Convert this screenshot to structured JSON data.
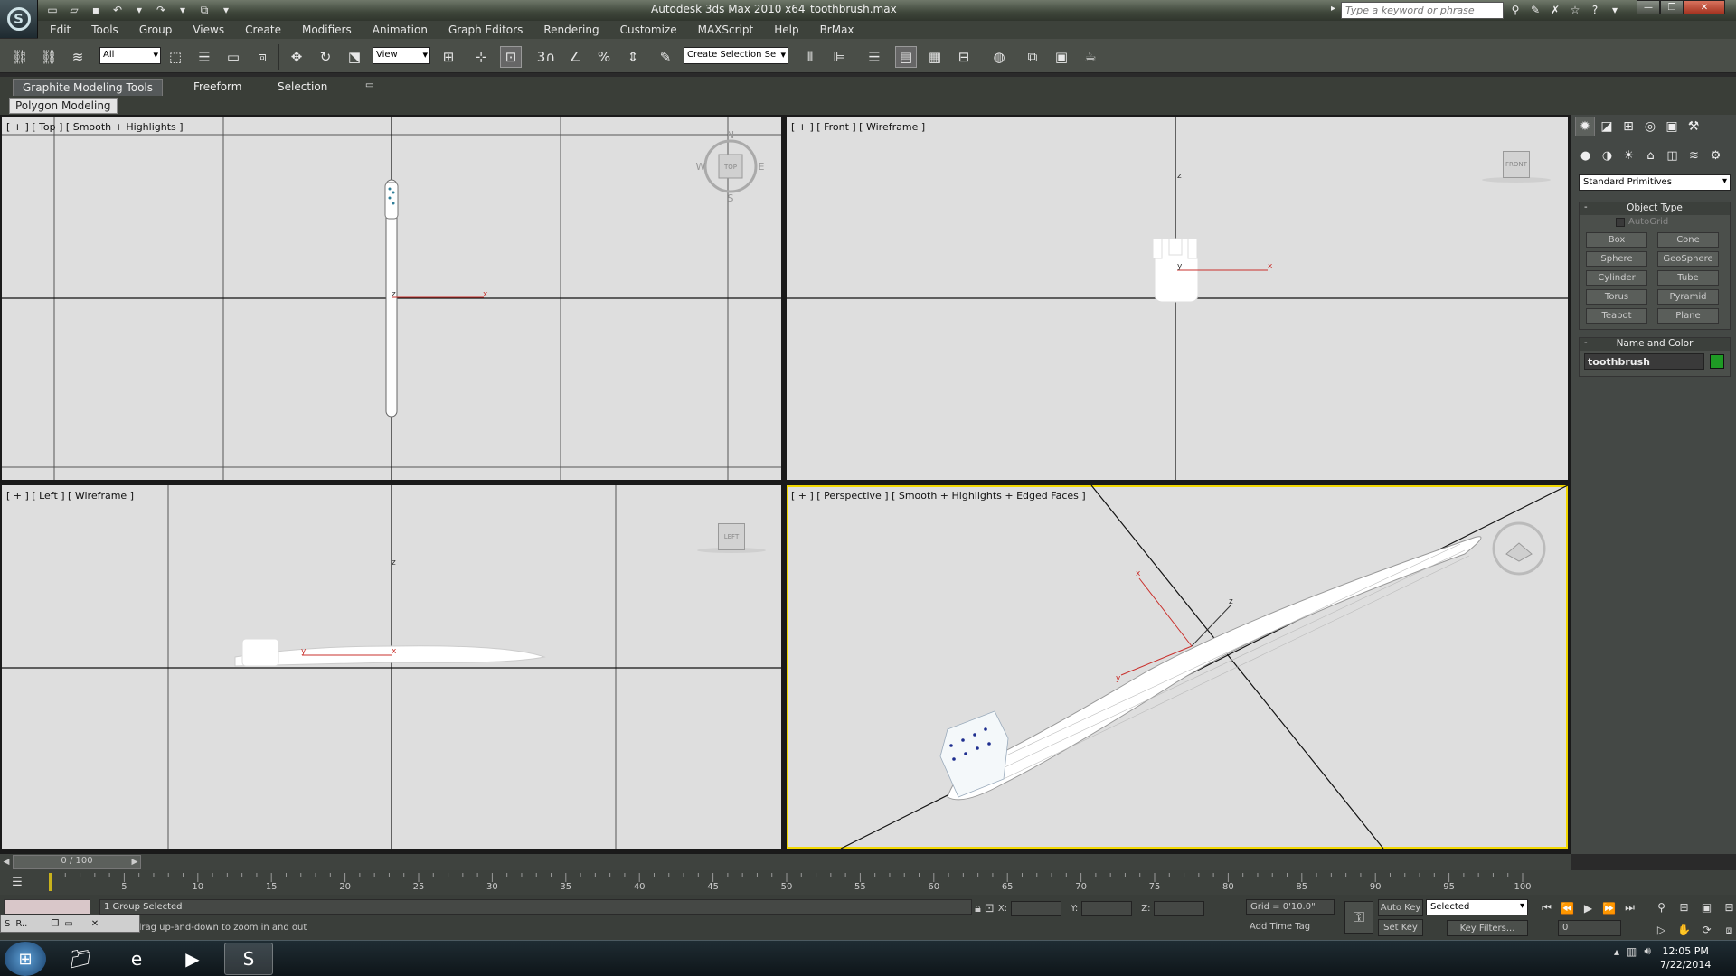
{
  "titlebar": {
    "title": "Autodesk 3ds Max  2010 x64",
    "file": "toothbrush.max",
    "search_placeholder": "Type a keyword or phrase"
  },
  "menu": [
    "Edit",
    "Tools",
    "Group",
    "Views",
    "Create",
    "Modifiers",
    "Animation",
    "Graph Editors",
    "Rendering",
    "Customize",
    "MAXScript",
    "Help",
    "BrMax"
  ],
  "toolbar": {
    "filter_select": "All",
    "coord_select": "View",
    "snap_3": "3",
    "named_selection": "Create Selection Se"
  },
  "ribbon": {
    "tabs": [
      "Graphite Modeling Tools",
      "Freeform",
      "Selection"
    ],
    "panel": "Polygon Modeling"
  },
  "viewports": {
    "top": {
      "label": "[ + ] [ Top ] [ Smooth + Highlights ]",
      "compass": {
        "n": "N",
        "s": "S",
        "e": "E",
        "w": "W",
        "cube": "TOP"
      }
    },
    "front": {
      "label": "[ + ] [ Front ] [ Wireframe ]",
      "cube": "FRONT"
    },
    "left": {
      "label": "[ + ] [ Left ] [ Wireframe ]",
      "cube": "LEFT"
    },
    "perspective": {
      "label": "[ + ] [ Perspective ] [ Smooth + Highlights + Edged Faces ]"
    },
    "axis": {
      "x": "x",
      "y": "y",
      "z": "z"
    }
  },
  "command_panel": {
    "category": "Standard Primitives",
    "object_type_title": "Object Type",
    "autogrid": "AutoGrid",
    "primitives": [
      "Box",
      "Cone",
      "Sphere",
      "GeoSphere",
      "Cylinder",
      "Tube",
      "Torus",
      "Pyramid",
      "Teapot",
      "Plane"
    ],
    "name_color_title": "Name and Color",
    "object_name": "toothbrush",
    "object_color": "#1e9a24"
  },
  "timeline": {
    "frame_display": "0 / 100",
    "ticks": [
      5,
      10,
      15,
      20,
      25,
      30,
      35,
      40,
      45,
      50,
      55,
      60,
      65,
      70,
      75,
      80,
      85,
      90,
      95,
      100
    ]
  },
  "status": {
    "selection": "1 Group Selected",
    "prompt": "drag up-and-down to zoom in and out",
    "x_label": "X:",
    "y_label": "Y:",
    "z_label": "Z:",
    "grid": "Grid = 0'10.0\"",
    "add_time_tag": "Add Time Tag",
    "auto_key": "Auto Key",
    "set_key": "Set Key",
    "key_mode": "Selected",
    "key_filters": "Key Filters...",
    "current_frame": "0"
  },
  "listener": {
    "label": "R.."
  },
  "taskbar": {
    "time": "12:05 PM",
    "date": "7/22/2014"
  }
}
